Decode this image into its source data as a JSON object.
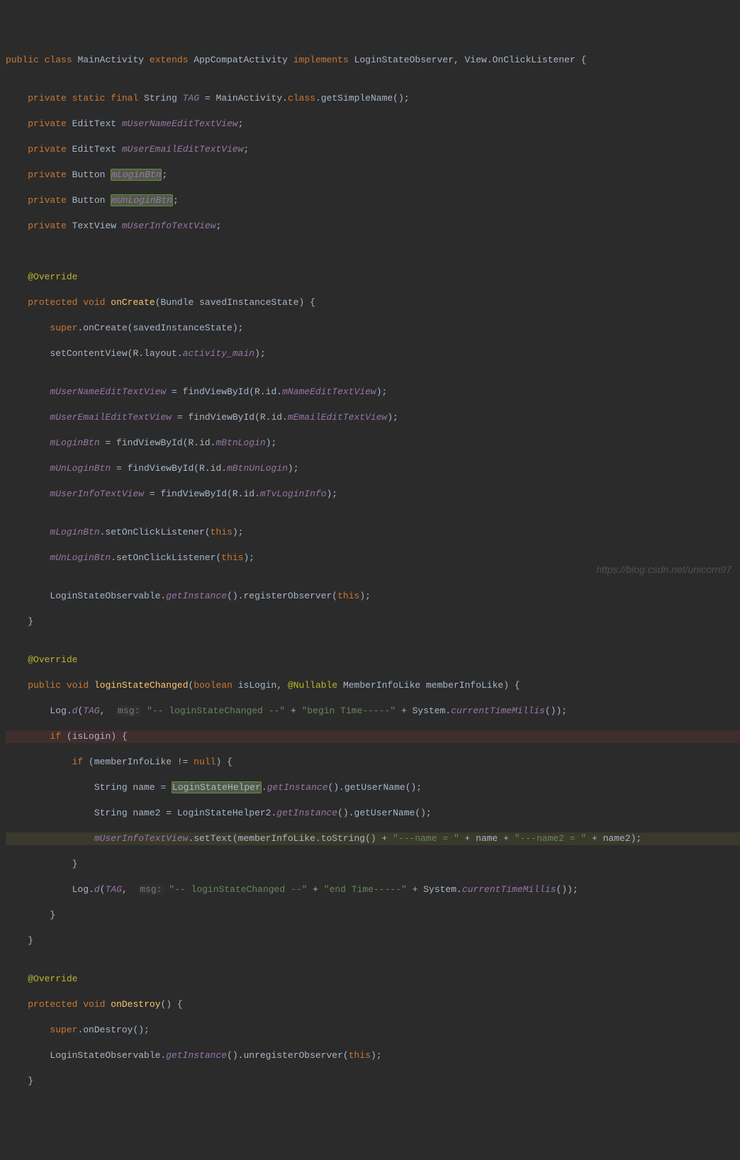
{
  "watermark": "https://blog.csdn.net/unicorn97",
  "code": {
    "l1": {
      "public": "public",
      "class": "class",
      "name": "MainActivity",
      "extends": "extends",
      "base": "AppCompatActivity",
      "implements": "implements",
      "iface1": "LoginStateObserver",
      "iface2": "View.OnClickListener",
      "obr": " {"
    },
    "l2": {
      "private": "private",
      "static": "static",
      "final": "final",
      "type": "String",
      "field": "TAG",
      "eq": " = MainActivity.",
      "class_kw": "class",
      "rest": ".getSimpleName();"
    },
    "l3": {
      "private": "private",
      "type": "EditText",
      "field": "mUserNameEditTextView",
      "semi": ";"
    },
    "l4": {
      "private": "private",
      "type": "EditText",
      "field": "mUserEmailEditTextView",
      "semi": ";"
    },
    "l5": {
      "private": "private",
      "type": "Button",
      "field": "mLoginBtn",
      "semi": ";"
    },
    "l6": {
      "private": "private",
      "type": "Button",
      "field": "mUnLoginBtn",
      "semi": ";"
    },
    "l7": {
      "private": "private",
      "type": "TextView",
      "field": "mUserInfoTextView",
      "semi": ";"
    },
    "ov1": "@Override",
    "l8": {
      "protected": "protected",
      "void": "void",
      "name": "onCreate",
      "args": "(Bundle savedInstanceState) {"
    },
    "l9": {
      "super": "super",
      "rest": ".onCreate(savedInstanceState);"
    },
    "l10": {
      "a": "setContentView(R.layout.",
      "b": "activity_main",
      "c": ");"
    },
    "l11": {
      "f": "mUserNameEditTextView",
      "a": " = findViewById(R.id.",
      "b": "mNameEditTextView",
      "c": ");"
    },
    "l12": {
      "f": "mUserEmailEditTextView",
      "a": " = findViewById(R.id.",
      "b": "mEmailEditTextView",
      "c": ");"
    },
    "l13": {
      "f": "mLoginBtn",
      "a": " = findViewById(R.id.",
      "b": "mBtnLogin",
      "c": ");"
    },
    "l14": {
      "f": "mUnLoginBtn",
      "a": " = findViewById(R.id.",
      "b": "mBtnUnLogin",
      "c": ");"
    },
    "l15": {
      "f": "mUserInfoTextView",
      "a": " = findViewById(R.id.",
      "b": "mTvLoginInfo",
      "c": ");"
    },
    "l16": {
      "f": "mLoginBtn",
      "a": ".setOnClickListener(",
      "this": "this",
      "c": ");"
    },
    "l17": {
      "f": "mUnLoginBtn",
      "a": ".setOnClickListener(",
      "this": "this",
      "c": ");"
    },
    "l18": {
      "a": "LoginStateObservable.",
      "b": "getInstance",
      "c": "().registerObserver(",
      "this": "this",
      "d": ");"
    },
    "cbr": "}",
    "ov2": "@Override",
    "l19": {
      "public": "public",
      "void": "void",
      "name": "loginStateChanged",
      "a": "(",
      "boolean": "boolean",
      "p1": " isLogin, ",
      "ann": "@Nullable",
      "p2": " MemberInfoLike memberInfoLike) {"
    },
    "l20": {
      "a": "Log.",
      "d": "d",
      "b": "(",
      "tag": "TAG",
      "c": ", ",
      "hint": "msg:",
      "s1": "\"-- loginStateChanged --\"",
      "p": " + ",
      "s2": "\"begin Time-----\"",
      "p2": " + System.",
      "m": "currentTimeMillis",
      "e": "());"
    },
    "l21": {
      "if": "if",
      "a": " (isLogin) {"
    },
    "l22": {
      "if": "if",
      "a": " (memberInfoLike != ",
      "null": "null",
      "b": ") {"
    },
    "l23": {
      "a": "String name = ",
      "h": "LoginStateHelper",
      "b": ".",
      "gi": "getInstance",
      "c": "().getUserName();"
    },
    "l24": {
      "a": "String name2 = LoginStateHelper2.",
      "gi": "getInstance",
      "c": "().getUserName();"
    },
    "l25": {
      "f": "mUserInfoTextView",
      "a": ".setText(",
      "h": "memberInfoLike.toString()",
      "p": " + ",
      "s1": "\"---name = \"",
      "p2": " + name + ",
      "s2": "\"---name2 = \"",
      "p3": " + name2);"
    },
    "l26": "}",
    "l27": {
      "a": "Log.",
      "d": "d",
      "b": "(",
      "tag": "TAG",
      "c": ", ",
      "hint": "msg:",
      "s1": "\"-- loginStateChanged --\"",
      "p": " + ",
      "s2": "\"end Time-----\"",
      "p2": " + System.",
      "m": "currentTimeMillis",
      "e": "());"
    },
    "l28": "}",
    "l29": "}",
    "ov3": "@Override",
    "l30": {
      "protected": "protected",
      "void": "void",
      "name": "onDestroy",
      "a": "() {"
    },
    "l31": {
      "super": "super",
      "a": ".onDestroy();"
    },
    "l32": {
      "a": "LoginStateObservable.",
      "b": "getInstance",
      "c": "().unregisterObserver(",
      "this": "this",
      "d": ");"
    },
    "l33": "}"
  }
}
